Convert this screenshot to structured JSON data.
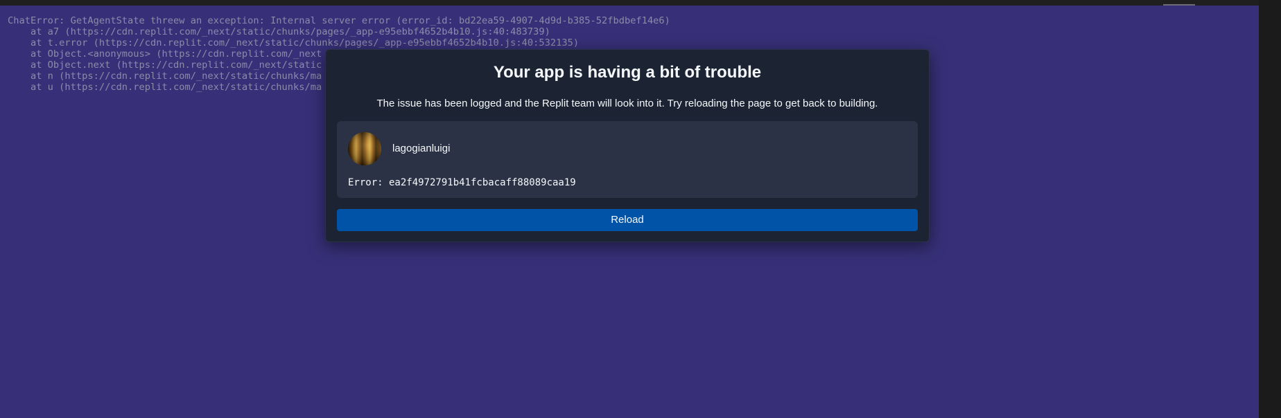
{
  "stack_trace": [
    "ChatError: GetAgentState threew an exception: Internal server error (error_id: bd22ea59-4907-4d9d-b385-52fbdbef14e6)",
    "    at a7 (https://cdn.replit.com/_next/static/chunks/pages/_app-e95ebbf4652b4b10.js:40:483739)",
    "    at t.error (https://cdn.replit.com/_next/static/chunks/pages/_app-e95ebbf4652b4b10.js:40:532135)",
    "    at Object.<anonymous> (https://cdn.replit.com/_next",
    "    at Object.next (https://cdn.replit.com/_next/static",
    "    at n (https://cdn.replit.com/_next/static/chunks/ma",
    "    at u (https://cdn.replit.com/_next/static/chunks/ma"
  ],
  "modal": {
    "title": "Your app is having a bit of trouble",
    "subtitle": "The issue has been logged and the Replit team will look into it. Try reloading the page to get back to building.",
    "user": {
      "username": "lagogianluigi",
      "avatar_icon": "user-photo-avatar"
    },
    "error_line": "Error: ea2f4972791b41fcbacaff88089caa19",
    "reload_label": "Reload"
  },
  "colors": {
    "page_background": "#373078",
    "modal_background": "#1c2333",
    "card_background": "#2b3245",
    "button_background": "#0053a6",
    "stack_text": "#8d8ba8",
    "text": "#f5f9fc"
  }
}
